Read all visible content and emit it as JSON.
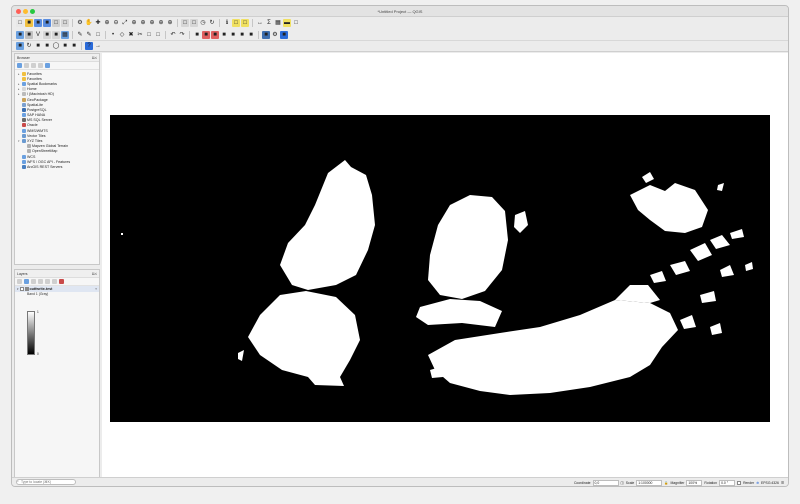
{
  "window": {
    "title": "*Untitled Project — QGIS"
  },
  "colors": {
    "map_bg": "#000000",
    "land": "#ffffff",
    "canvas_bg": "#ffffff",
    "accent": "#2a6ad8"
  },
  "toolbar": {
    "row1": [
      {
        "name": "new-project-icon",
        "glyph": "□",
        "color": "#e8e8e8"
      },
      {
        "name": "open-project-icon",
        "glyph": "■",
        "color": "#f0c040"
      },
      {
        "name": "save-project-icon",
        "glyph": "■",
        "color": "#5a8de0"
      },
      {
        "name": "save-as-icon",
        "glyph": "■",
        "color": "#5a8de0"
      },
      {
        "name": "print-layout-icon",
        "glyph": "□",
        "color": "#cfcfcf"
      },
      {
        "name": "layout-manager-icon",
        "glyph": "□",
        "color": "#d6d6d6"
      },
      {
        "name": "style-manager-icon",
        "glyph": "⚙",
        "color": "#ececec"
      },
      {
        "name": "pan-icon",
        "glyph": "✋",
        "color": "#ececec"
      },
      {
        "name": "pan-to-selection-icon",
        "glyph": "✚",
        "color": "#ececec"
      },
      {
        "name": "zoom-in-icon",
        "glyph": "⊕",
        "color": "#ececec"
      },
      {
        "name": "zoom-out-icon",
        "glyph": "⊖",
        "color": "#ececec"
      },
      {
        "name": "zoom-full-icon",
        "glyph": "⤢",
        "color": "#ececec"
      },
      {
        "name": "zoom-selection-icon",
        "glyph": "⊕",
        "color": "#ececec"
      },
      {
        "name": "zoom-layer-icon",
        "glyph": "⊕",
        "color": "#ececec"
      },
      {
        "name": "zoom-native-icon",
        "glyph": "⊕",
        "color": "#ececec"
      },
      {
        "name": "zoom-last-icon",
        "glyph": "⊕",
        "color": "#ececec"
      },
      {
        "name": "zoom-next-icon",
        "glyph": "⊕",
        "color": "#ececec"
      },
      {
        "name": "new-map-view-icon",
        "glyph": "□",
        "color": "#d6d6d6"
      },
      {
        "name": "new-3d-view-icon",
        "glyph": "□",
        "color": "#d6d6d6"
      },
      {
        "name": "temporal-icon",
        "glyph": "◷",
        "color": "#ececec"
      },
      {
        "name": "refresh-icon",
        "glyph": "↻",
        "color": "#ececec"
      },
      {
        "name": "identify-icon",
        "glyph": "ℹ",
        "color": "#ececec"
      },
      {
        "name": "select-features-icon",
        "glyph": "□",
        "color": "#f0e060"
      },
      {
        "name": "deselect-icon",
        "glyph": "□",
        "color": "#f0e060"
      },
      {
        "name": "measure-icon",
        "glyph": "↔",
        "color": "#ececec"
      },
      {
        "name": "statistics-icon",
        "glyph": "Σ",
        "color": "#ececec"
      },
      {
        "name": "attribute-table-icon",
        "glyph": "▦",
        "color": "#ececec"
      },
      {
        "name": "map-tips-icon",
        "glyph": "▬",
        "color": "#f0e060"
      },
      {
        "name": "annotation-icon",
        "glyph": "□",
        "color": "#ececec"
      }
    ],
    "row2": [
      {
        "name": "data-source-manager-icon",
        "glyph": "■",
        "color": "#6aa0e0"
      },
      {
        "name": "new-geopackage-icon",
        "glyph": "■",
        "color": "#c0c0c0"
      },
      {
        "name": "new-shapefile-icon",
        "glyph": "V",
        "color": "#e8e8e8"
      },
      {
        "name": "new-spatialite-icon",
        "glyph": "■",
        "color": "#d6d6d6"
      },
      {
        "name": "new-temp-layer-icon",
        "glyph": "■",
        "color": "#d6d6d6"
      },
      {
        "name": "add-raster-icon",
        "glyph": "▦",
        "color": "#6aa0e0"
      },
      {
        "name": "digitize-icon",
        "glyph": "✎",
        "color": "#ececec"
      },
      {
        "name": "toggle-edit-icon",
        "glyph": "✎",
        "color": "#ececec"
      },
      {
        "name": "save-edits-icon",
        "glyph": "□",
        "color": "#ececec"
      },
      {
        "name": "add-point-icon",
        "glyph": "•",
        "color": "#ececec"
      },
      {
        "name": "vertex-tool-icon",
        "glyph": "◇",
        "color": "#ececec"
      },
      {
        "name": "delete-selected-icon",
        "glyph": "✖",
        "color": "#ececec"
      },
      {
        "name": "cut-features-icon",
        "glyph": "✂",
        "color": "#ececec"
      },
      {
        "name": "copy-features-icon",
        "glyph": "□",
        "color": "#ececec"
      },
      {
        "name": "paste-features-icon",
        "glyph": "□",
        "color": "#ececec"
      },
      {
        "name": "undo-icon",
        "glyph": "↶",
        "color": "#ececec"
      },
      {
        "name": "redo-icon",
        "glyph": "↷",
        "color": "#ececec"
      },
      {
        "name": "label-tool-icon",
        "glyph": "■",
        "color": "#ececec"
      },
      {
        "name": "label-pin-icon",
        "glyph": "■",
        "color": "#e06060"
      },
      {
        "name": "label-highlight-icon",
        "glyph": "■",
        "color": "#e06060"
      },
      {
        "name": "label-move-icon",
        "glyph": "■",
        "color": "#ececec"
      },
      {
        "name": "label-rotate-icon",
        "glyph": "■",
        "color": "#ececec"
      },
      {
        "name": "label-change-icon",
        "glyph": "■",
        "color": "#ececec"
      },
      {
        "name": "diagram-icon",
        "glyph": "■",
        "color": "#ececec"
      },
      {
        "name": "python-console-icon",
        "glyph": "■",
        "color": "#3d6fb0"
      },
      {
        "name": "processing-toolbox-icon",
        "glyph": "⚙",
        "color": "#ececec"
      },
      {
        "name": "plugin-icon",
        "glyph": "■",
        "color": "#2a6ad8"
      }
    ],
    "row3": [
      {
        "name": "add-vector-icon",
        "glyph": "■",
        "color": "#6aa0e0"
      },
      {
        "name": "rotate-feature-icon",
        "glyph": "↻",
        "color": "#ececec"
      },
      {
        "name": "offset-icon",
        "glyph": "■",
        "color": "#ececec"
      },
      {
        "name": "simplify-icon",
        "glyph": "■",
        "color": "#ececec"
      },
      {
        "name": "add-ring-icon",
        "glyph": "◯",
        "color": "#ececec"
      },
      {
        "name": "add-part-icon",
        "glyph": "■",
        "color": "#ececec"
      },
      {
        "name": "fill-ring-icon",
        "glyph": "■",
        "color": "#ececec"
      },
      {
        "name": "help-icon",
        "glyph": "?",
        "color": "#2a6ad8"
      },
      {
        "name": "whats-this-icon",
        "glyph": "→",
        "color": "#ececec"
      }
    ]
  },
  "browser": {
    "title": "Browser",
    "items": [
      {
        "label": "Favorites",
        "depth": 0,
        "icon": "star-icon",
        "color": "#f0c040",
        "caret": "▸"
      },
      {
        "label": "Favorites",
        "depth": 0,
        "icon": "star-icon",
        "color": "#f0c040",
        "caret": ""
      },
      {
        "label": "Spatial Bookmarks",
        "depth": 0,
        "icon": "bookmark-icon",
        "color": "#6aa0e0",
        "caret": "▸"
      },
      {
        "label": "Home",
        "depth": 0,
        "icon": "home-icon",
        "color": "#d6d6d6",
        "caret": "▸"
      },
      {
        "label": "/ (Macintosh HD)",
        "depth": 0,
        "icon": "drive-icon",
        "color": "#bbbbbb",
        "caret": "▸"
      },
      {
        "label": "GeoPackage",
        "depth": 0,
        "icon": "geopackage-icon",
        "color": "#c9a25a",
        "caret": ""
      },
      {
        "label": "SpatiaLite",
        "depth": 0,
        "icon": "spatialite-icon",
        "color": "#7aa0d0",
        "caret": ""
      },
      {
        "label": "PostgreSQL",
        "depth": 0,
        "icon": "postgres-icon",
        "color": "#3d6fb0",
        "caret": ""
      },
      {
        "label": "SAP HANA",
        "depth": 0,
        "icon": "hana-icon",
        "color": "#6aa0e0",
        "caret": ""
      },
      {
        "label": "MS SQL Server",
        "depth": 0,
        "icon": "mssql-icon",
        "color": "#6a6a6a",
        "caret": ""
      },
      {
        "label": "Oracle",
        "depth": 0,
        "icon": "oracle-icon",
        "color": "#c94a4a",
        "caret": ""
      },
      {
        "label": "WMS/WMTS",
        "depth": 0,
        "icon": "wms-icon",
        "color": "#6aa0e0",
        "caret": ""
      },
      {
        "label": "Vector Tiles",
        "depth": 0,
        "icon": "vector-tiles-icon",
        "color": "#6a9ad0",
        "caret": ""
      },
      {
        "label": "XYZ Tiles",
        "depth": 0,
        "icon": "xyz-icon",
        "color": "#6a9ad0",
        "caret": "▾"
      },
      {
        "label": "Mapzen Global Terrain",
        "depth": 1,
        "icon": "tile-layer-icon",
        "color": "#b0b0b0",
        "caret": ""
      },
      {
        "label": "OpenStreetMap",
        "depth": 1,
        "icon": "tile-layer-icon",
        "color": "#b0b0b0",
        "caret": ""
      },
      {
        "label": "WCS",
        "depth": 0,
        "icon": "wcs-icon",
        "color": "#6aa0e0",
        "caret": ""
      },
      {
        "label": "WFS / OGC API - Features",
        "depth": 0,
        "icon": "wfs-icon",
        "color": "#6aa0e0",
        "caret": ""
      },
      {
        "label": "ArcGIS REST Servers",
        "depth": 0,
        "icon": "arcgis-icon",
        "color": "#4a80c0",
        "caret": ""
      }
    ]
  },
  "layers": {
    "title": "Layers",
    "layer_name": "outfwrite-test",
    "band_label": "Band 1 (Gray)",
    "max_value": "1",
    "min_value": "0",
    "badge": "T"
  },
  "status": {
    "locator_placeholder": "Type to locate (⌘K)",
    "coordinate_label": "Coordinate",
    "coordinate_value": "0,0",
    "scale_label": "Scale",
    "scale_value": "1:100000",
    "magnifier_label": "Magnifier",
    "magnifier_value": "100%",
    "rotation_label": "Rotation",
    "rotation_value": "0.0 °",
    "render_label": "Render",
    "crs_label": "EPSG:4326"
  }
}
